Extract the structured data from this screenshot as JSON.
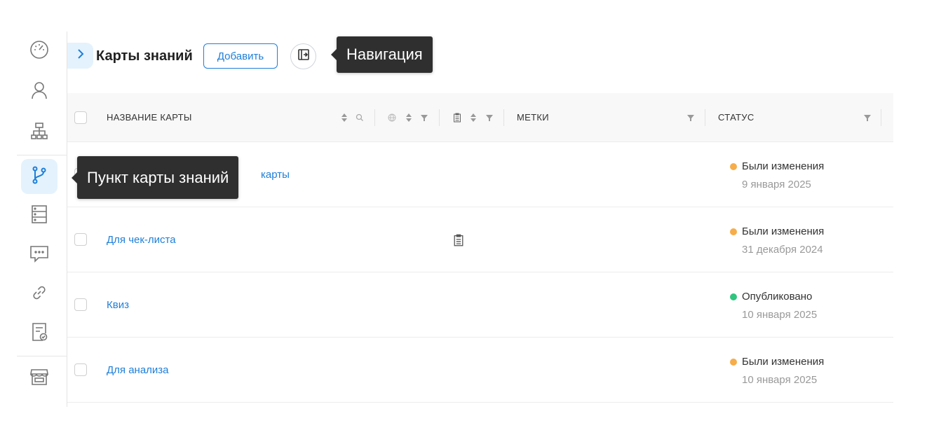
{
  "header": {
    "title": "Карты знаний",
    "add_label": "Добавить"
  },
  "tooltips": {
    "navigation": "Навигация",
    "sidebar_item": "Пункт карты знаний"
  },
  "sidebar": {
    "items": [
      {
        "icon": "dashboard-icon"
      },
      {
        "icon": "user-icon"
      },
      {
        "icon": "org-structure-icon"
      },
      {
        "icon": "knowledge-map-icon",
        "active": true
      },
      {
        "icon": "server-icon"
      },
      {
        "icon": "chat-icon"
      },
      {
        "icon": "link-icon"
      },
      {
        "icon": "document-check-icon"
      },
      {
        "icon": "store-icon"
      }
    ]
  },
  "table": {
    "columns": {
      "name": "НАЗВАНИЕ КАРТЫ",
      "tags": "МЕТКИ",
      "status": "СТАТУС"
    },
    "rows": [
      {
        "name": "карты",
        "status": "Были изменения",
        "date": "9 января 2025",
        "status_color": "#f6ad4a"
      },
      {
        "name": "Для чек-листа",
        "status": "Были изменения",
        "date": "31 декабря 2024",
        "status_color": "#f6ad4a",
        "has_checklist_icon": true
      },
      {
        "name": "Квиз",
        "status": "Опубликовано",
        "date": "10 января 2025",
        "status_color": "#2fc57f"
      },
      {
        "name": "Для анализа",
        "status": "Были изменения",
        "date": "10 января 2025",
        "status_color": "#f6ad4a"
      }
    ]
  },
  "colors": {
    "accent": "#1e7fd8",
    "changed": "#f6ad4a",
    "published": "#2fc57f",
    "tooltip_bg": "#2f2f2f"
  }
}
